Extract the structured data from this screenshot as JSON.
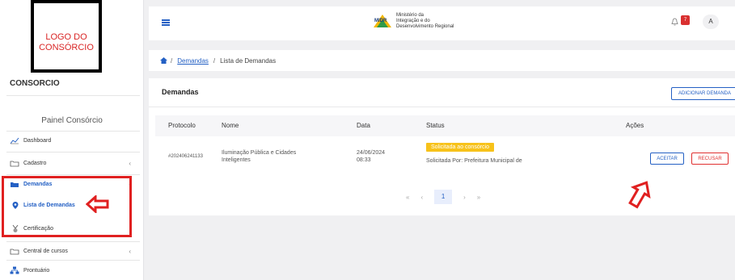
{
  "sidebar": {
    "logo_text": "LOGO DO\nCONSÓRCIO",
    "org_name": "CONSORCIO",
    "panel_title": "Painel Consórcio",
    "items": [
      {
        "label": "Dashboard",
        "icon": "chart-line-icon"
      },
      {
        "label": "Cadastro",
        "icon": "folder-icon",
        "chevron": "‹"
      },
      {
        "label": "Demandas",
        "icon": "folder-open-icon",
        "chevron": "‹"
      },
      {
        "label": "Central de cursos",
        "icon": "folder-icon",
        "chevron": "‹"
      },
      {
        "label": "Prontuário",
        "icon": "sitemap-icon"
      }
    ],
    "sub_items": [
      {
        "label": "Lista de Demandas",
        "icon": "location-pin-icon"
      },
      {
        "label": "Certificação",
        "icon": "medal-icon"
      }
    ]
  },
  "topbar": {
    "ministry_logo": "MIDR",
    "ministry_lines": [
      "Ministério da",
      "Integração e do",
      "Desenvolvimento Regional"
    ],
    "notification_count": "7",
    "user_initial": "A"
  },
  "breadcrumb": {
    "link": "Demandas",
    "current": "Lista de Demandas",
    "separator": "/"
  },
  "card": {
    "title": "Demandas",
    "add_button": "ADICIONAR DEMANDA",
    "columns": [
      "Protocolo",
      "Nome",
      "Data",
      "Status",
      "Ações"
    ],
    "rows": [
      {
        "protocolo": "#202406241133",
        "nome_line1": "Iluminação Pública e Cidades",
        "nome_line2": "Inteligentes",
        "data_line1": "24/06/2024",
        "data_line2": "08:33",
        "status": "Solicitada ao consórcio",
        "solicitada_por": "Solicitada Por: Prefeitura Municipal de",
        "accept": "ACEITAR",
        "refuse": "RECUSAR"
      }
    ],
    "pagination": {
      "first": "«",
      "prev": "‹",
      "current": "1",
      "next": "›",
      "last": "»"
    }
  },
  "colors": {
    "accent": "#2460c4",
    "danger": "#e02020",
    "warning": "#f7c21a"
  }
}
